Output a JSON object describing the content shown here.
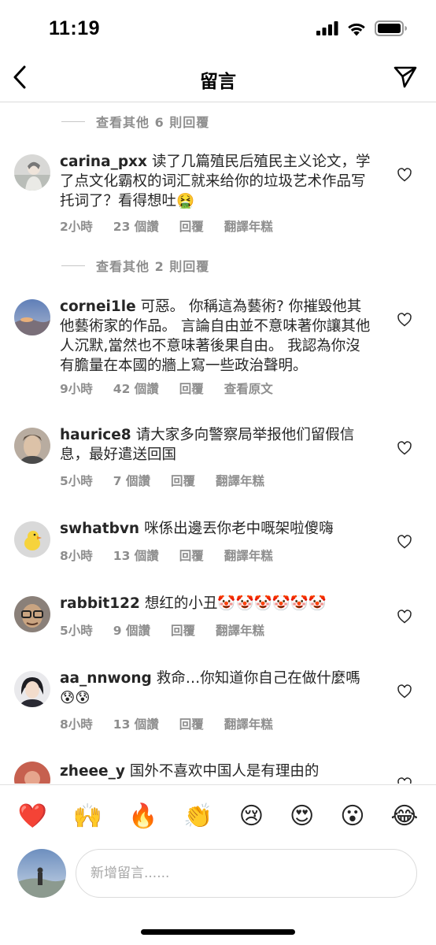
{
  "status_bar": {
    "time": "11:19"
  },
  "nav": {
    "title": "留言"
  },
  "comments": [
    {
      "view_more_above": "查看其他 6 則回覆",
      "username": "carina_pxx",
      "text": "读了几篇殖民后殖民主义论文，学了点文化霸权的词汇就来给你的垃圾艺术作品写托词了？看得想吐🤮",
      "time": "2小時",
      "likes": "23 個讚",
      "reply": "回覆",
      "action": "翻譯年糕"
    },
    {
      "view_more_above": "查看其他 2 則回覆",
      "username": "cornei1le",
      "text": "可惡。 你稱這為藝術? 你摧毀他其他藝術家的作品。 言論自由並不意味著你讓其他人沉默,當然也不意味著後果自由。 我認為你沒有膽量在本國的牆上寫一些政治聲明。",
      "time": "9小時",
      "likes": "42 個讚",
      "reply": "回覆",
      "action": "查看原文"
    },
    {
      "username": "haurice8",
      "text": "请大家多向警察局举报他们留假信息，最好遣送回国",
      "time": "5小時",
      "likes": "7 個讚",
      "reply": "回覆",
      "action": "翻譯年糕"
    },
    {
      "username": "swhatbvn",
      "text": "咪係出邊丟你老中嘅架啦傻嗨",
      "time": "8小時",
      "likes": "13 個讚",
      "reply": "回覆",
      "action": "翻譯年糕"
    },
    {
      "username": "rabbit122",
      "text": "想红的小丑🤡🤡🤡🤡🤡🤡",
      "time": "5小時",
      "likes": "9 個讚",
      "reply": "回覆",
      "action": "翻譯年糕"
    },
    {
      "username": "aa_nnwong",
      "text": "救命…你知道你自己在做什麼嗎😰😰",
      "time": "8小時",
      "likes": "13 個讚",
      "reply": "回覆",
      "action": "翻譯年糕"
    },
    {
      "username": "zheee_y",
      "text": "国外不喜欢中国人是有理由的"
    }
  ],
  "reactions": [
    "❤️",
    "🙌",
    "🔥",
    "👏",
    "😢",
    "😍",
    "😮",
    "😂"
  ],
  "composer": {
    "placeholder": "新增留言......"
  },
  "colors": {
    "text": "#262626",
    "meta": "#8e8e8e",
    "border": "#dbdbdb",
    "heart_red": "#ed4956"
  }
}
